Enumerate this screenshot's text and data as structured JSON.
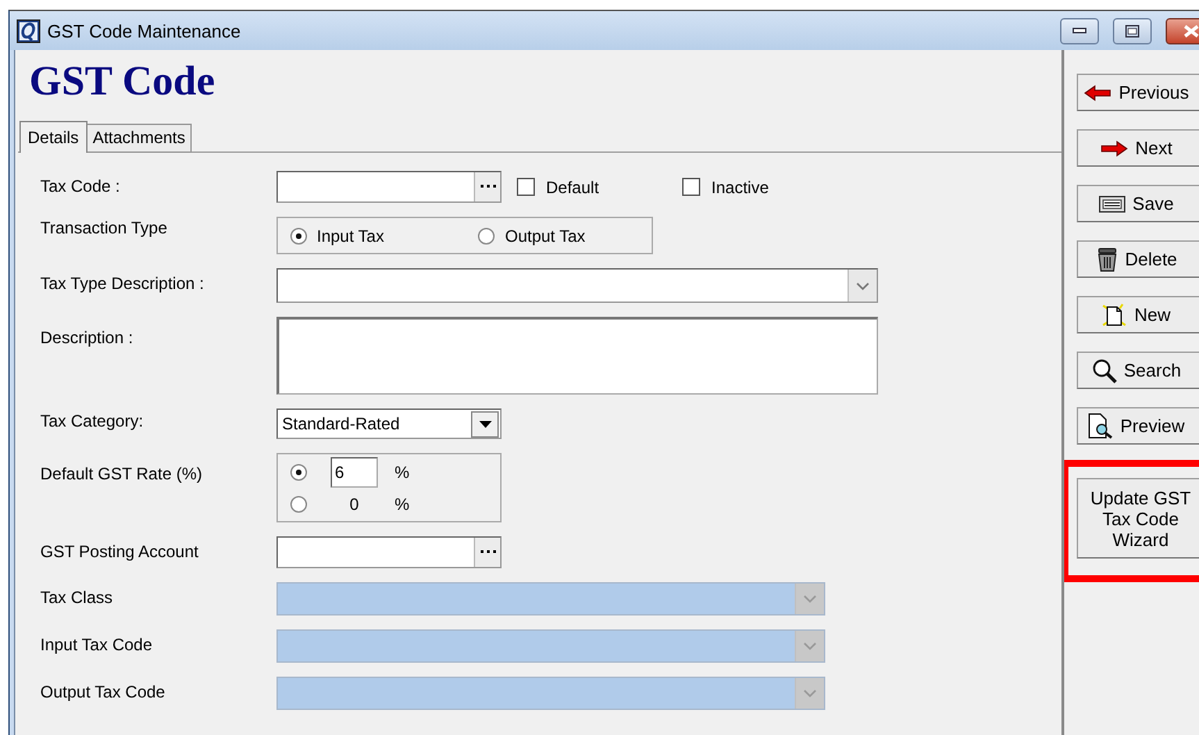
{
  "window": {
    "title": "GST Code Maintenance"
  },
  "heading": "GST Code",
  "tabs": [
    {
      "label": "Details",
      "selected": true
    },
    {
      "label": "Attachments",
      "selected": false
    }
  ],
  "fields": [
    {
      "kind": "lookup",
      "label": "Tax Code :",
      "checkboxes": [
        {
          "label": "Default",
          "checked": false
        },
        {
          "label": "Inactive",
          "checked": false
        }
      ]
    },
    {
      "kind": "radios",
      "label": "Transaction Type",
      "options": [
        {
          "label": "Input Tax",
          "selected": true
        },
        {
          "label": "Output Tax",
          "selected": false
        }
      ]
    },
    {
      "kind": "combo",
      "label": "Tax Type Description :",
      "disabled": false
    },
    {
      "kind": "memo",
      "label": "Description :"
    },
    {
      "kind": "dropdown",
      "label": "Tax Category:",
      "value": "Standard-Rated"
    },
    {
      "kind": "rate",
      "label": "Default GST Rate (%)",
      "options": [
        {
          "value": "6",
          "unit": "%",
          "selected": true,
          "editable": true
        },
        {
          "value": "0",
          "unit": "%",
          "selected": false,
          "editable": false
        }
      ]
    },
    {
      "kind": "lookup",
      "label": "GST Posting Account"
    },
    {
      "kind": "combo",
      "label": "Tax Class",
      "disabled": true
    },
    {
      "kind": "combo",
      "label": "Input Tax Code",
      "disabled": true
    },
    {
      "kind": "combo",
      "label": "Output Tax Code",
      "disabled": true
    }
  ],
  "buttons": [
    {
      "kind": "previous",
      "label": "Previous",
      "highlighted": false
    },
    {
      "kind": "next",
      "label": "Next",
      "highlighted": false
    },
    {
      "kind": "save",
      "label": "Save",
      "highlighted": false
    },
    {
      "kind": "delete",
      "label": "Delete",
      "highlighted": false
    },
    {
      "kind": "new",
      "label": "New",
      "highlighted": false
    },
    {
      "kind": "search",
      "label": "Search",
      "highlighted": false
    },
    {
      "kind": "preview",
      "label": "Preview",
      "highlighted": false
    },
    {
      "kind": "wizard",
      "label": "Update GST\nTax Code\nWizard",
      "highlighted": true
    }
  ]
}
